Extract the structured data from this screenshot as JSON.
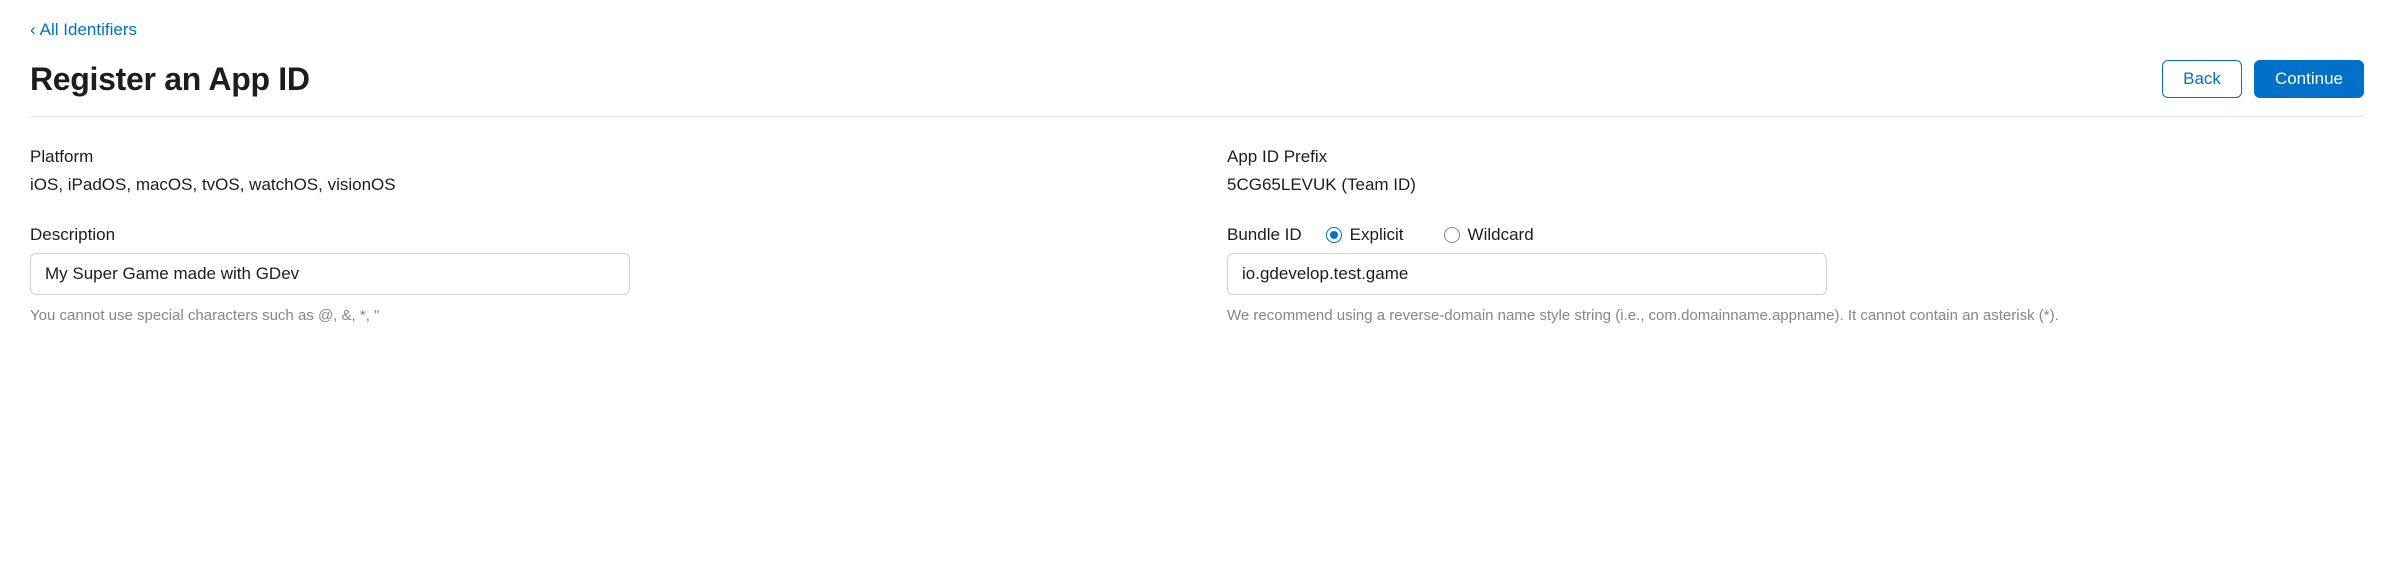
{
  "breadcrumb": {
    "back_link": "All Identifiers"
  },
  "header": {
    "title": "Register an App ID",
    "back_button": "Back",
    "continue_button": "Continue"
  },
  "form": {
    "platform": {
      "label": "Platform",
      "value": "iOS, iPadOS, macOS, tvOS, watchOS, visionOS"
    },
    "app_id_prefix": {
      "label": "App ID Prefix",
      "value": "5CG65LEVUK (Team ID)"
    },
    "description": {
      "label": "Description",
      "value": "My Super Game made with GDev",
      "hint": "You cannot use special characters such as @, &, *, \""
    },
    "bundle_id": {
      "label": "Bundle ID",
      "radio_explicit": "Explicit",
      "radio_wildcard": "Wildcard",
      "selected": "explicit",
      "value": "io.gdevelop.test.game",
      "hint": "We recommend using a reverse-domain name style string (i.e., com.domainname.appname). It cannot contain an asterisk (*)."
    }
  }
}
